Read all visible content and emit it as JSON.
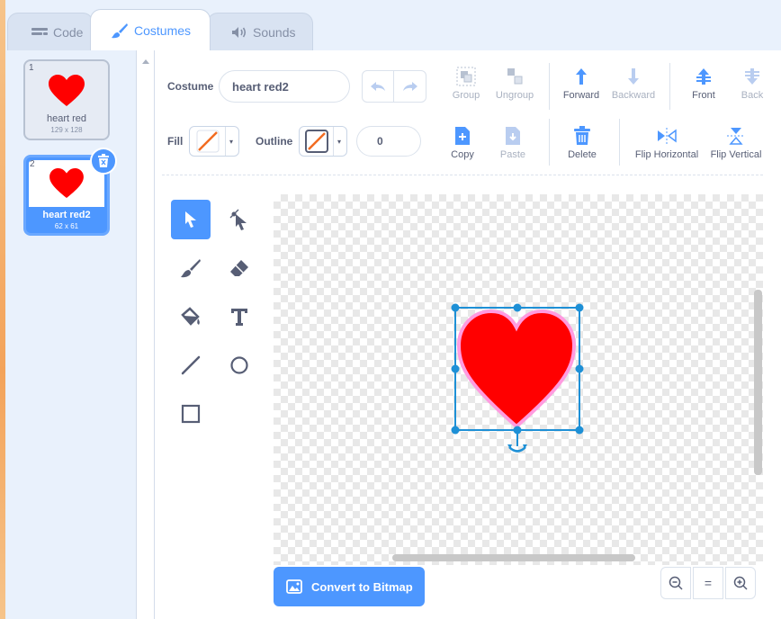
{
  "tabs": [
    {
      "label": "Code",
      "icon": "code-icon"
    },
    {
      "label": "Costumes",
      "icon": "brush-icon",
      "active": true
    },
    {
      "label": "Sounds",
      "icon": "speaker-icon"
    }
  ],
  "costumes": [
    {
      "number": "1",
      "name": "heart red",
      "size": "129 x 128"
    },
    {
      "number": "2",
      "name": "heart red2",
      "size": "62 x 61",
      "selected": true
    }
  ],
  "toolbar": {
    "costume_label": "Costume",
    "costume_name": "heart red2",
    "group": "Group",
    "ungroup": "Ungroup",
    "forward": "Forward",
    "backward": "Backward",
    "front": "Front",
    "back": "Back",
    "fill_label": "Fill",
    "outline_label": "Outline",
    "outline_width": "0",
    "copy": "Copy",
    "paste": "Paste",
    "delete": "Delete",
    "flip_horizontal": "Flip Horizontal",
    "flip_vertical": "Flip Vertical"
  },
  "canvas": {
    "shape_color": "#ff0000",
    "selection_color": "#1e90d6"
  },
  "bottom": {
    "convert_label": "Convert to Bitmap",
    "zoom_out": "−",
    "zoom_reset": "=",
    "zoom_in": "+"
  },
  "colors": {
    "accent": "#4d97ff",
    "fill_stroke": "#f26b21"
  }
}
